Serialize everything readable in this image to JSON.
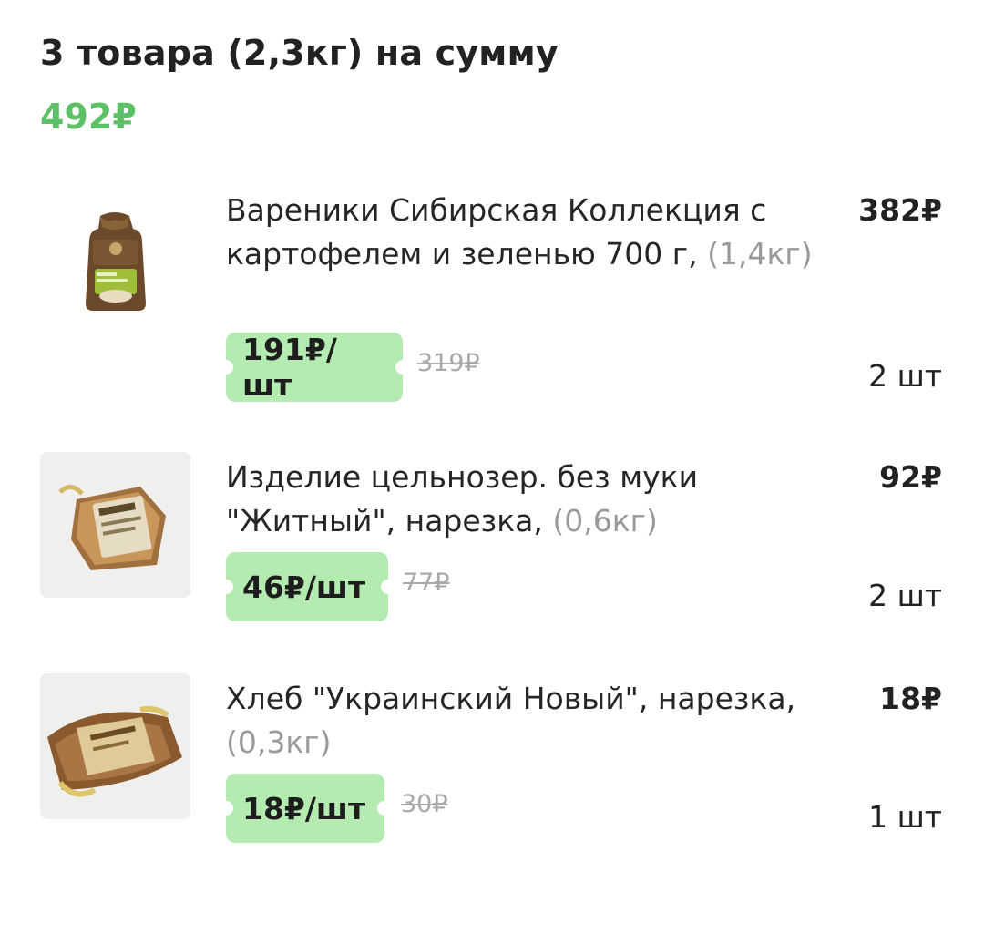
{
  "summary": {
    "title": "3 товара (2,3кг) на сумму",
    "total": "492₽"
  },
  "items": [
    {
      "name": "Вареники Сибирская Коллекция с картофелем и зеленью 700 г,",
      "weight": "(1,4кг)",
      "line_total": "382₽",
      "unit_price": "191₽/шт",
      "old_price": "319₽",
      "quantity": "2 шт",
      "image_icon": "dumplings-package-icon"
    },
    {
      "name": "Изделие цельнозер. без муки \"Житный\", нарезка,",
      "weight": "(0,6кг)",
      "line_total": "92₽",
      "unit_price": "46₽/шт",
      "old_price": "77₽",
      "quantity": "2 шт",
      "image_icon": "bread-loaf-icon"
    },
    {
      "name": "Хлеб \"Украинский Новый\", нарезка,",
      "weight": "(0,3кг)",
      "line_total": "18₽",
      "unit_price": "18₽/шт",
      "old_price": "30₽",
      "quantity": "1 шт",
      "image_icon": "bread-loaf-icon"
    }
  ],
  "colors": {
    "accent_green": "#5cc066",
    "price_tag_bg": "#b4ebb0",
    "muted_text": "#9a9a9a"
  }
}
